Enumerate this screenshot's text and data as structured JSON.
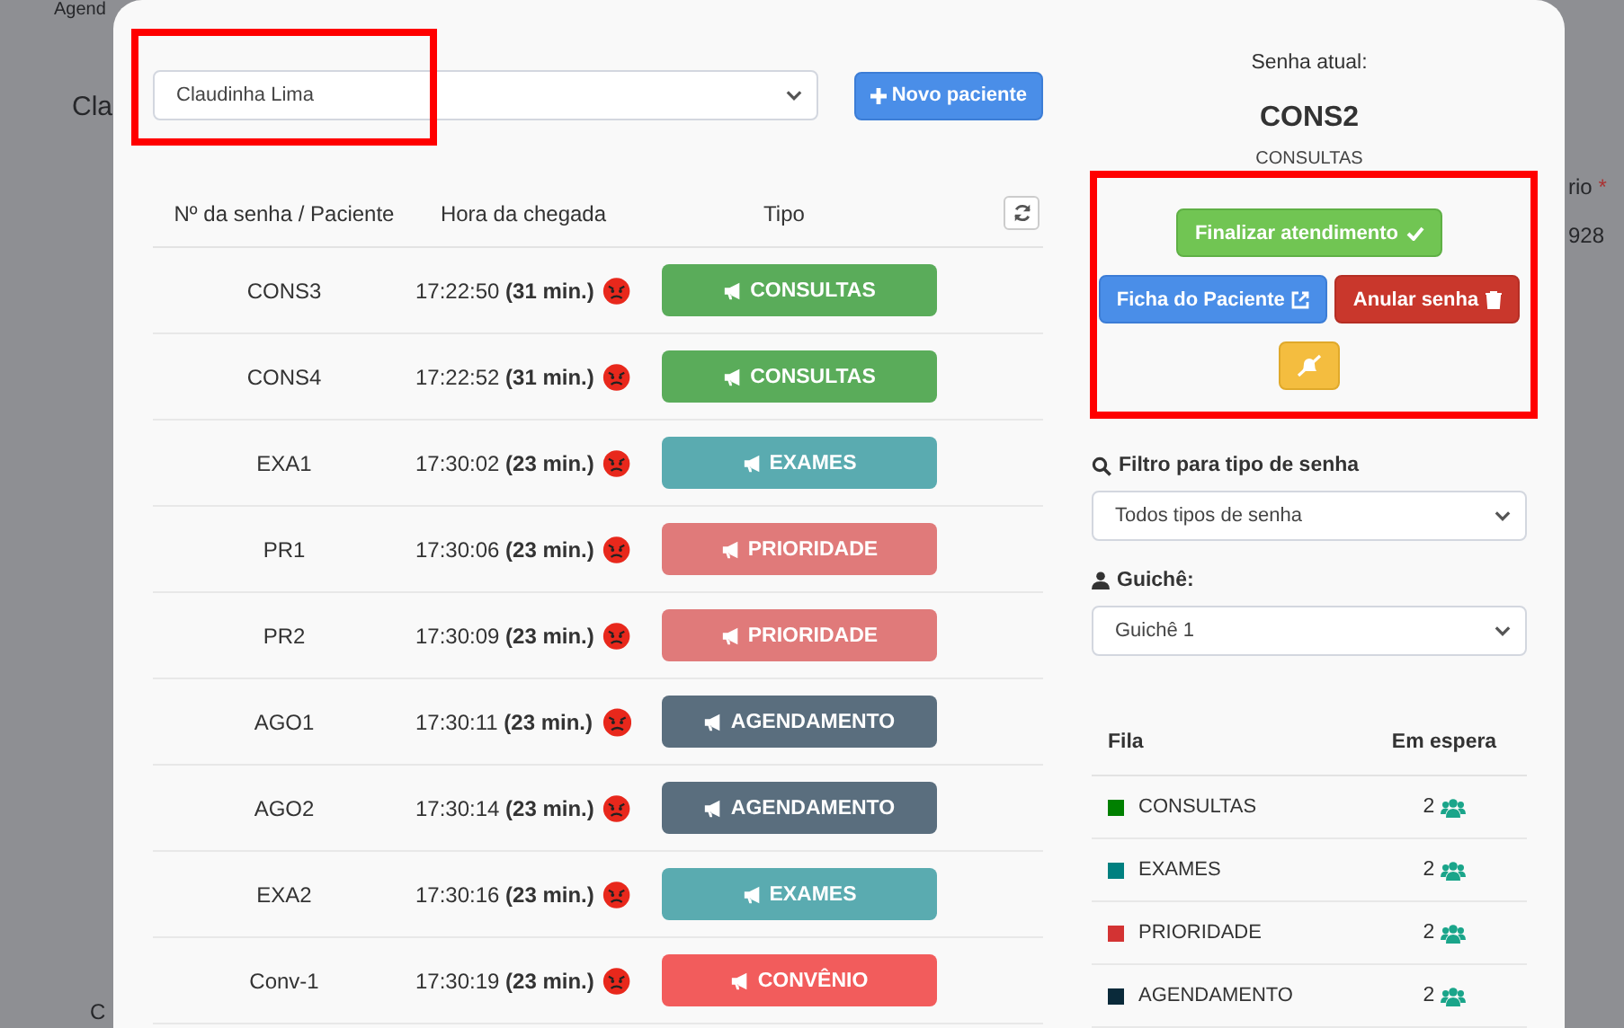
{
  "background_page": {
    "nav_text": "Agend",
    "heading": "Cla",
    "field_label": "rio",
    "required_mark": "*",
    "field_value": "928",
    "footer_button": "C"
  },
  "patient_select": {
    "value": "Claudinha Lima"
  },
  "new_patient_button": "Novo paciente",
  "queue_table": {
    "columns": [
      "Nº da senha / Paciente",
      "Hora da chegada",
      "Tipo"
    ],
    "rows": [
      {
        "ticket": "CONS3",
        "arrival": "17:22:50 **(31 min.)**",
        "type": "CONSULTAS",
        "color": "#5aac5a"
      },
      {
        "ticket": "CONS4",
        "arrival": "17:22:52 **(31 min.)**",
        "type": "CONSULTAS",
        "color": "#5aac5a"
      },
      {
        "ticket": "EXA1",
        "arrival": "17:30:02 **(23 min.)**",
        "type": "EXAMES",
        "color": "#5aabb0"
      },
      {
        "ticket": "PR1",
        "arrival": "17:30:06 **(23 min.)**",
        "type": "PRIORIDADE",
        "color": "#e07a7a"
      },
      {
        "ticket": "PR2",
        "arrival": "17:30:09 **(23 min.)**",
        "type": "PRIORIDADE",
        "color": "#e07a7a"
      },
      {
        "ticket": "AGO1",
        "arrival": "17:30:11 **(23 min.)**",
        "type": "AGENDAMENTO",
        "color": "#5a6e7e"
      },
      {
        "ticket": "AGO2",
        "arrival": "17:30:14 **(23 min.)**",
        "type": "AGENDAMENTO",
        "color": "#5a6e7e"
      },
      {
        "ticket": "EXA2",
        "arrival": "17:30:16 **(23 min.)**",
        "type": "EXAMES",
        "color": "#5aabb0"
      },
      {
        "ticket": "Conv-1",
        "arrival": "17:30:19 **(23 min.)**",
        "type": "CONVÊNIO",
        "color": "#f25c5c"
      }
    ]
  },
  "current": {
    "label": "Senha atual:",
    "ticket": "CONS2",
    "type": "CONSULTAS"
  },
  "actions": {
    "finish": "Finalizar atendimento",
    "record": "Ficha do Paciente",
    "cancel": "Anular senha"
  },
  "filter": {
    "label": "Filtro para tipo de senha",
    "value": "Todos tipos de senha"
  },
  "counter": {
    "label": "Guichê:",
    "value": "Guichê 1"
  },
  "summary": {
    "columns": [
      "Fila",
      "Em espera"
    ],
    "rows": [
      {
        "queue": "CONSULTAS",
        "waiting": "2",
        "color": "#008000"
      },
      {
        "queue": "EXAMES",
        "waiting": "2",
        "color": "#008080"
      },
      {
        "queue": "PRIORIDADE",
        "waiting": "2",
        "color": "#d33333"
      },
      {
        "queue": "AGENDAMENTO",
        "waiting": "2",
        "color": "#0a2a3a"
      }
    ]
  }
}
